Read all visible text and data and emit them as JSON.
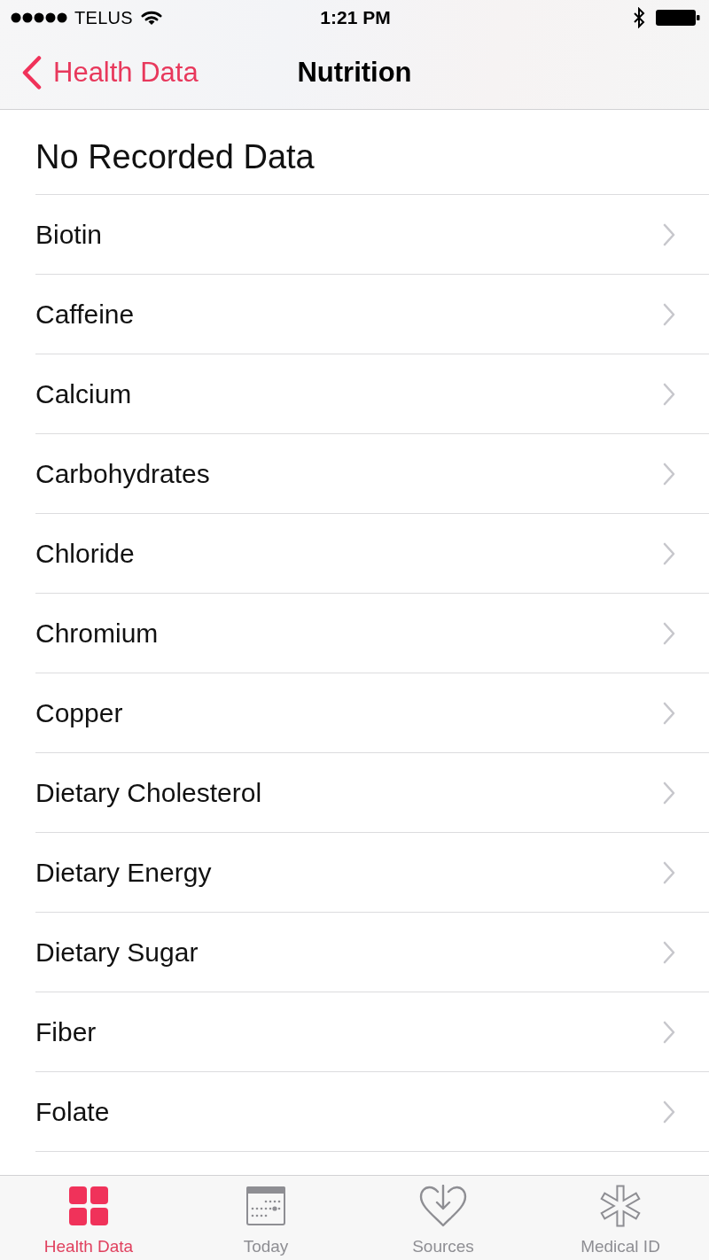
{
  "status_bar": {
    "carrier": "TELUS",
    "time": "1:21 PM"
  },
  "nav_bar": {
    "back": "Health Data",
    "title": "Nutrition"
  },
  "list": {
    "header": "No Recorded Data",
    "items": [
      "Biotin",
      "Caffeine",
      "Calcium",
      "Carbohydrates",
      "Chloride",
      "Chromium",
      "Copper",
      "Dietary Cholesterol",
      "Dietary Energy",
      "Dietary Sugar",
      "Fiber",
      "Folate"
    ]
  },
  "tab_bar": {
    "tabs": [
      {
        "label": "Health Data",
        "kind": "health-data",
        "selected": true
      },
      {
        "label": "Today",
        "kind": "today",
        "selected": false
      },
      {
        "label": "Sources",
        "kind": "sources",
        "selected": false
      },
      {
        "label": "Medical ID",
        "kind": "medical-id",
        "selected": false
      }
    ]
  }
}
